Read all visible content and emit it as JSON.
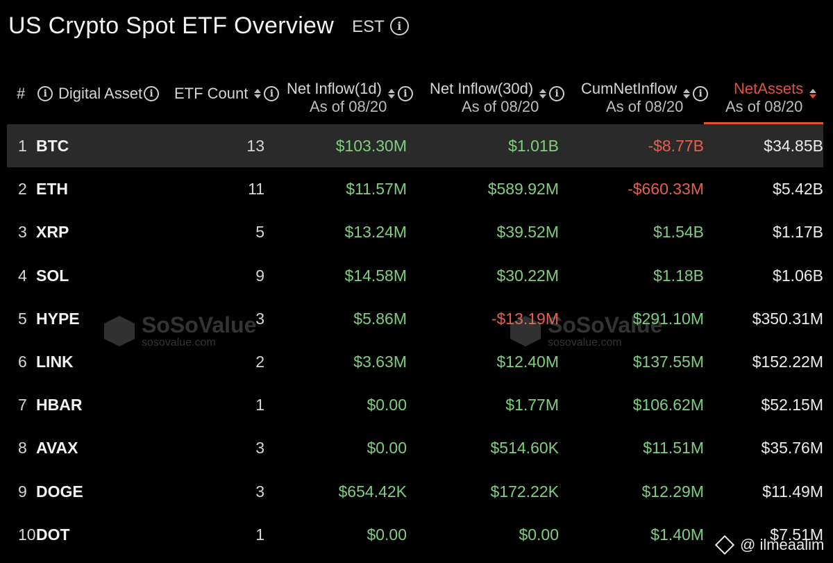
{
  "header": {
    "title": "US Crypto Spot ETF Overview",
    "timezone": "EST",
    "info_icon": "info-icon"
  },
  "columns": {
    "rank": "#",
    "asset": "Digital Asset",
    "etf_count": "ETF Count",
    "net_inflow_1d": "Net Inflow(1d)",
    "net_inflow_30d": "Net Inflow(30d)",
    "cum_net_inflow": "CumNetInflow",
    "net_assets": "NetAssets",
    "as_of": "As of 08/20"
  },
  "sorted_column": "net_assets",
  "rows": [
    {
      "rank": "1",
      "asset": "BTC",
      "etf_count": "13",
      "net_inflow_1d": "$103.30M",
      "net_inflow_30d": "$1.01B",
      "cum_net_inflow": "-$8.77B",
      "net_assets": "$34.85B"
    },
    {
      "rank": "2",
      "asset": "ETH",
      "etf_count": "11",
      "net_inflow_1d": "$11.57M",
      "net_inflow_30d": "$589.92M",
      "cum_net_inflow": "-$660.33M",
      "net_assets": "$5.42B"
    },
    {
      "rank": "3",
      "asset": "XRP",
      "etf_count": "5",
      "net_inflow_1d": "$13.24M",
      "net_inflow_30d": "$39.52M",
      "cum_net_inflow": "$1.54B",
      "net_assets": "$1.17B"
    },
    {
      "rank": "4",
      "asset": "SOL",
      "etf_count": "9",
      "net_inflow_1d": "$14.58M",
      "net_inflow_30d": "$30.22M",
      "cum_net_inflow": "$1.18B",
      "net_assets": "$1.06B"
    },
    {
      "rank": "5",
      "asset": "HYPE",
      "etf_count": "3",
      "net_inflow_1d": "$5.86M",
      "net_inflow_30d": "-$13.19M",
      "cum_net_inflow": "$291.10M",
      "net_assets": "$350.31M"
    },
    {
      "rank": "6",
      "asset": "LINK",
      "etf_count": "2",
      "net_inflow_1d": "$3.63M",
      "net_inflow_30d": "$12.40M",
      "cum_net_inflow": "$137.55M",
      "net_assets": "$152.22M"
    },
    {
      "rank": "7",
      "asset": "HBAR",
      "etf_count": "1",
      "net_inflow_1d": "$0.00",
      "net_inflow_30d": "$1.77M",
      "cum_net_inflow": "$106.62M",
      "net_assets": "$52.15M"
    },
    {
      "rank": "8",
      "asset": "AVAX",
      "etf_count": "3",
      "net_inflow_1d": "$0.00",
      "net_inflow_30d": "$514.60K",
      "cum_net_inflow": "$11.51M",
      "net_assets": "$35.76M"
    },
    {
      "rank": "9",
      "asset": "DOGE",
      "etf_count": "3",
      "net_inflow_1d": "$654.42K",
      "net_inflow_30d": "$172.22K",
      "cum_net_inflow": "$12.29M",
      "net_assets": "$11.49M"
    },
    {
      "rank": "10",
      "asset": "DOT",
      "etf_count": "1",
      "net_inflow_1d": "$0.00",
      "net_inflow_30d": "$0.00",
      "cum_net_inflow": "$1.40M",
      "net_assets": "$7.51M"
    }
  ],
  "watermark": {
    "brand": "SoSoValue",
    "url": "sosovalue.com"
  },
  "credit": {
    "handle": "@ ilmeaalim"
  },
  "colors": {
    "positive": "#7ed07e",
    "negative": "#e5604b",
    "accent": "#e0533b",
    "highlight_row": "#2a2a2a"
  }
}
